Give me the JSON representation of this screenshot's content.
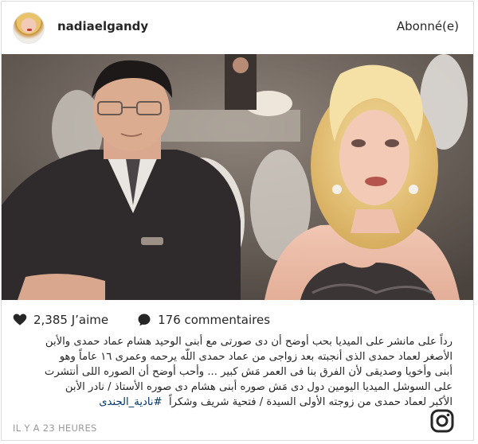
{
  "header": {
    "username": "nadiaelgandy",
    "follow_label": "Abonné(e)"
  },
  "stats": {
    "likes": "2,385 J’aime",
    "comments": "176 commentaires"
  },
  "caption": {
    "lines": [
      "رداً على مانشر على الميديا بحب أوضح أن دى صورتى مع أبنى الوحيد هشام عماد حمدى والأبن",
      "الأصغر لعماد حمدى الذى أنجبته بعد زواجى من عماد حمدى اللّه يرحمه وعمرى ١٦ عاماً وهو",
      "أبنى وأخويا وصديقى لأن الفرق بنا فى العمر مَش كبير ... وأحب أوضح أن الصوره اللى أنتشرت",
      "على السوشل الميديا اليومين دول دى مَش صوره أبنى هشام دى صوره الأستاذ / نادر الأبن",
      "الأكبر لعماد حمدى من زوجته الأولى السيدة / فتحية شريف وشكراً"
    ],
    "hashtag": "#نادية_الجندى"
  },
  "timestamp": "IL Y A 23 HEURES",
  "icons": {
    "heart": "heart-icon",
    "comment": "comment-bubble-icon",
    "logo": "instagram-logo-icon"
  }
}
